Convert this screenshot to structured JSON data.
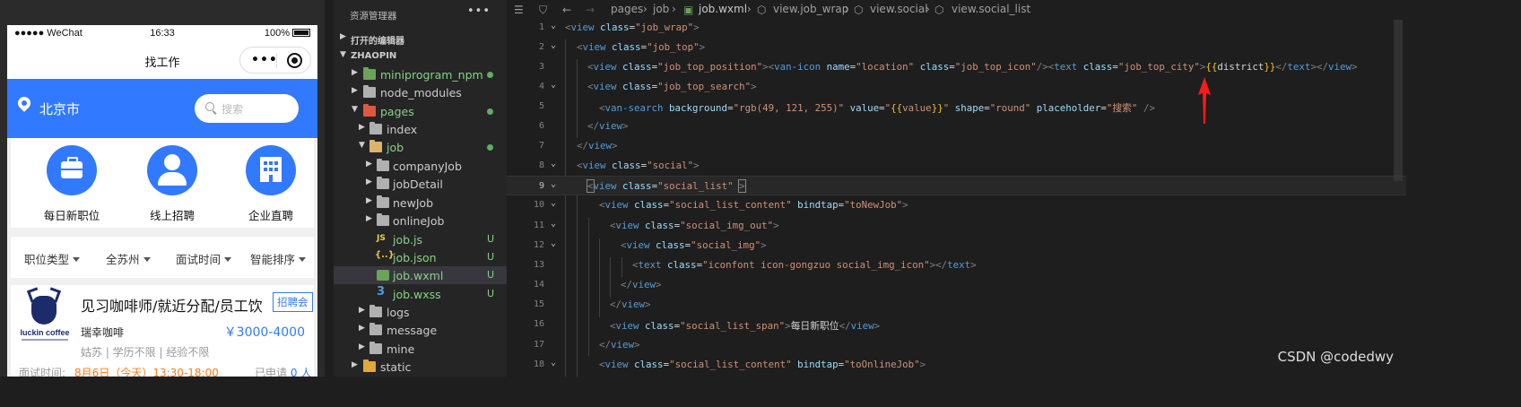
{
  "phone": {
    "status": {
      "carrier": "●●●●● WeChat",
      "time": "16:33",
      "battery": "100%"
    },
    "nav_title": "找工作",
    "capsule": {
      "more": "•••"
    },
    "city": "北京市",
    "search_placeholder": "搜索",
    "social_items": [
      "每日新职位",
      "线上招聘",
      "企业直聘"
    ],
    "filters": [
      "职位类型",
      "全苏州",
      "面试时间",
      "智能排序"
    ],
    "job": {
      "title": "见习咖啡师/就近分配/员工饮",
      "tag": "招聘会",
      "company": "瑞幸咖啡",
      "salary": "￥3000-4000",
      "meta": "姑苏 | 学历不限 | 经验不限",
      "interview_label": "面试时间:",
      "interview_time": "8月6日（今天）13:30-18:00",
      "applied_prefix": "已申请",
      "applied_count": "0",
      "applied_suffix": "人",
      "logo_text": "luckin coffee"
    }
  },
  "explorer": {
    "title": "资源管理器",
    "more": "•••",
    "section_open_editors": "打开的编辑器",
    "section_project": "ZHAOPIN",
    "tree": [
      {
        "label": "miniprogram_npm",
        "status": "dot",
        "color": "#89d185"
      },
      {
        "label": "node_modules",
        "status": "",
        "color": "#cccccc"
      },
      {
        "label": "pages",
        "status": "dot",
        "color": "#89d185"
      },
      {
        "label": "index",
        "status": "",
        "color": "#cccccc"
      },
      {
        "label": "job",
        "status": "dot",
        "color": "#89d185"
      },
      {
        "label": "companyJob",
        "status": "",
        "color": "#cccccc"
      },
      {
        "label": "jobDetail",
        "status": "",
        "color": "#cccccc"
      },
      {
        "label": "newJob",
        "status": "",
        "color": "#cccccc"
      },
      {
        "label": "onlineJob",
        "status": "",
        "color": "#cccccc"
      },
      {
        "label": "job.js",
        "status": "U",
        "color": "#89d185"
      },
      {
        "label": "job.json",
        "status": "U",
        "color": "#89d185"
      },
      {
        "label": "job.wxml",
        "status": "U",
        "color": "#89d185"
      },
      {
        "label": "job.wxss",
        "status": "U",
        "color": "#89d185"
      },
      {
        "label": "logs",
        "status": "",
        "color": "#cccccc"
      },
      {
        "label": "message",
        "status": "",
        "color": "#cccccc"
      },
      {
        "label": "mine",
        "status": "",
        "color": "#cccccc"
      },
      {
        "label": "static",
        "status": "",
        "color": "#cccccc"
      }
    ]
  },
  "editor": {
    "breadcrumb": [
      "pages",
      "job",
      "job.wxml",
      "view.job_wrap",
      "view.social",
      "view.social_list"
    ],
    "line_numbers": [
      "1",
      "2",
      "3",
      "4",
      "5",
      "6",
      "7",
      "8",
      "9",
      "10",
      "11",
      "12",
      "13",
      "14",
      "15",
      "16",
      "17",
      "18"
    ],
    "watermark": "CSDN @codedwy"
  },
  "colors": {
    "accent": "#3179ff",
    "editor_bg": "#1e1e1e",
    "sidebar_bg": "#252526",
    "git_untracked": "#89d185",
    "arrow": "#ff1a1a"
  },
  "icons": [
    "location-icon",
    "search-icon",
    "briefcase-icon",
    "user-icon",
    "building-icon",
    "caret-down-icon",
    "folder-icon",
    "back-arrow-icon",
    "forward-arrow-icon",
    "bookmark-icon",
    "list-icon",
    "red-arrow-icon"
  ]
}
